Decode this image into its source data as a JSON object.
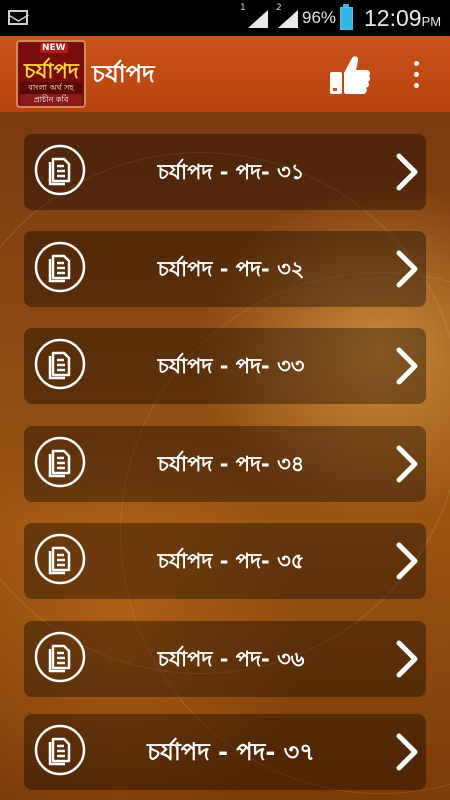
{
  "status_bar": {
    "sim1": "1",
    "sim2": "2",
    "battery": "96%",
    "time": "12:09",
    "ampm": "PM",
    "icons": [
      "mail-icon",
      "signal-icon",
      "battery-icon"
    ]
  },
  "app_bar": {
    "title": "চর্যাপদ",
    "logo": {
      "badge": "NEW",
      "name": "চর্যাপদ",
      "line1": "বাংলা অর্থ সহ",
      "line2": "প্রাচীন কবি"
    },
    "icons": [
      "thumbs-up-icon",
      "overflow-menu-icon"
    ]
  },
  "items": [
    {
      "label": "চর্যাপদ - পদ- ৩১"
    },
    {
      "label": "চর্যাপদ - পদ- ৩২"
    },
    {
      "label": "চর্যাপদ - পদ- ৩৩"
    },
    {
      "label": "চর্যাপদ - পদ- ৩৪"
    },
    {
      "label": "চর্যাপদ - পদ- ৩৫"
    },
    {
      "label": "চর্যাপদ - পদ- ৩৬"
    },
    {
      "label": "চর্যাপদ - পদ- ৩৭"
    }
  ],
  "colors": {
    "app_bar": "#c9521b",
    "item_bg": "rgba(0,0,0,0.36)",
    "text": "#ffffff",
    "battery": "#33b5e5"
  }
}
